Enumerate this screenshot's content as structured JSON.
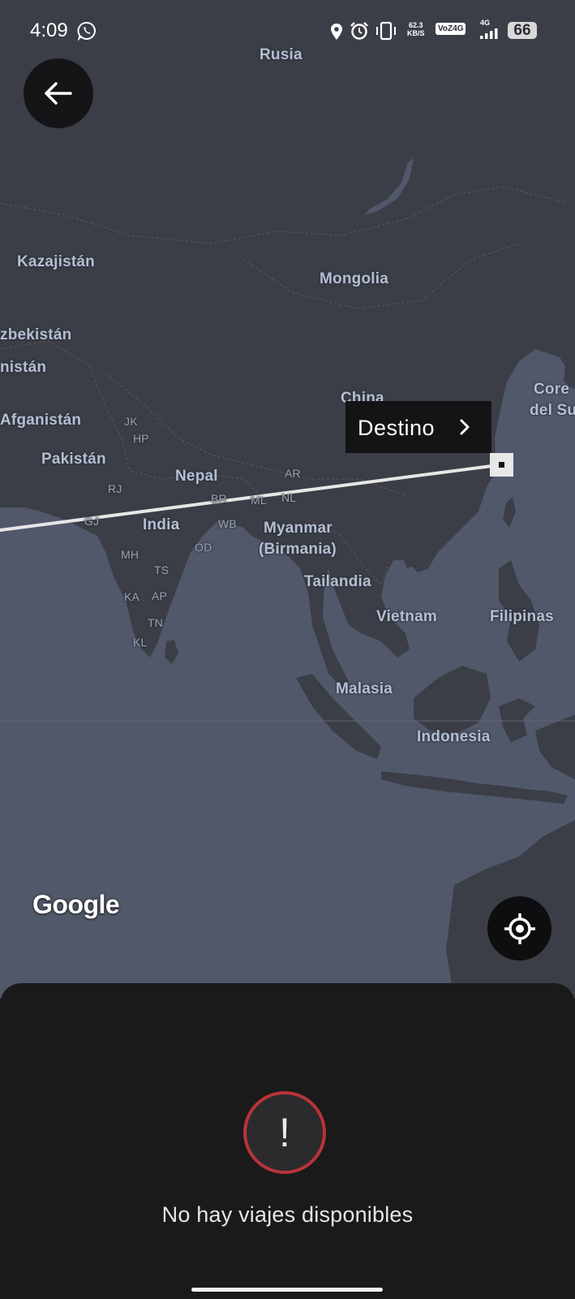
{
  "status_bar": {
    "time": "4:09",
    "net_speed_value": "62.3",
    "net_speed_unit": "KB/S",
    "volte": "VoZ4G",
    "network": "4G",
    "battery": "66",
    "icons": [
      "whatsapp-icon",
      "location-icon",
      "alarm-icon",
      "vibrate-icon",
      "signal-icon",
      "battery-icon"
    ]
  },
  "map": {
    "countries": {
      "russia": "Rusia",
      "kazakhstan": "Kazajistán",
      "mongolia": "Mongolia",
      "uzbekistan": "zbekistán",
      "turkmenistan": "nistán",
      "afghanistan": "Afganistán",
      "pakistan": "Pakistán",
      "nepal": "Nepal",
      "china": "China",
      "korea_1": "Core",
      "korea_2": "del Su",
      "india": "India",
      "myanmar_1": "Myanmar",
      "myanmar_2": "(Birmania)",
      "thailand": "Tailandia",
      "vietnam": "Vietnam",
      "philippines": "Filipinas",
      "malaysia": "Malasia",
      "indonesia": "Indonesia"
    },
    "states": {
      "jk": "JK",
      "hp": "HP",
      "rj": "RJ",
      "gj": "GJ",
      "br": "BR",
      "ml": "ML",
      "nl": "NL",
      "ar": "AR",
      "wb": "WB",
      "od": "OD",
      "mh": "MH",
      "ts": "TS",
      "ka": "KA",
      "ap": "AP",
      "tn": "TN",
      "kl": "KL"
    },
    "attribution": "Google",
    "colors": {
      "land": "#3b3e47",
      "water": "#51586a",
      "route": "#e7e7e7"
    }
  },
  "destination": {
    "label": "Destino",
    "chevron_icon": "chevron-right-icon"
  },
  "controls": {
    "back_icon": "arrow-left-icon",
    "locate_icon": "crosshair-icon"
  },
  "sheet": {
    "alert_icon": "exclamation-circle-icon",
    "alert_mark": "!",
    "message": "No hay viajes disponibles",
    "alert_color": "#b73439"
  }
}
